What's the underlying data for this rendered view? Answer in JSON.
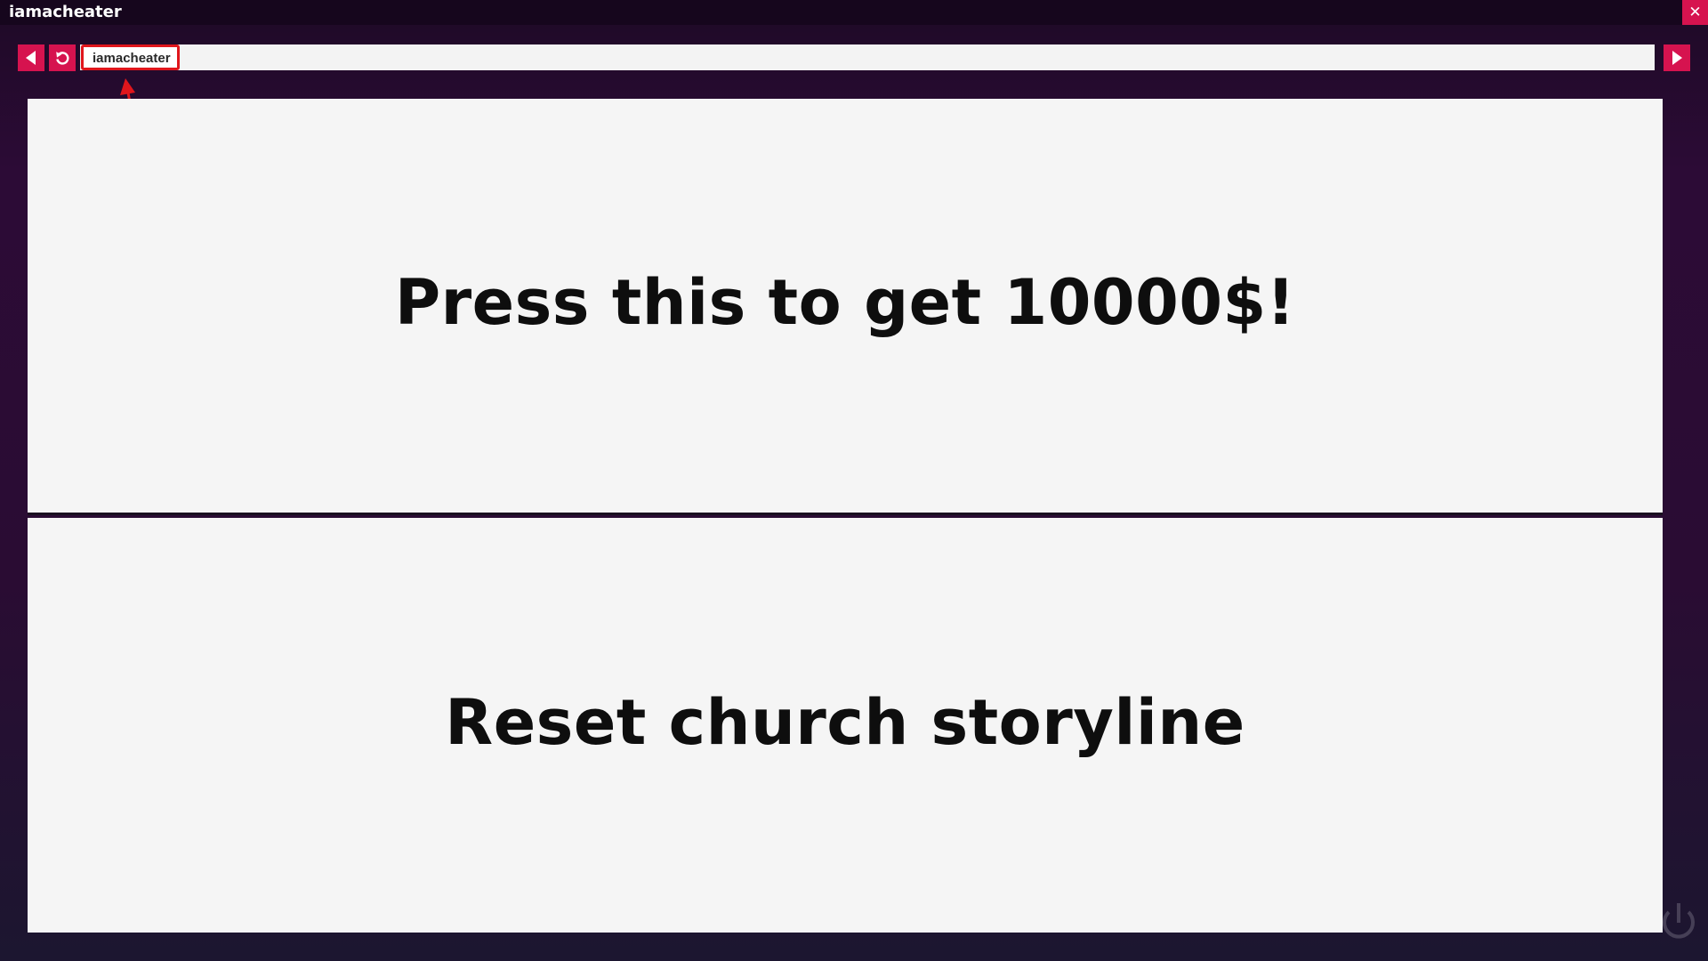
{
  "window": {
    "title": "iamacheater",
    "close_glyph": "✕"
  },
  "toolbar": {
    "back_icon": "back-arrow-icon",
    "reload_icon": "reload-icon",
    "forward_icon": "forward-arrow-icon",
    "accent_color": "#d6134f"
  },
  "address_bar": {
    "value": "iamacheater",
    "highlight_color": "#e0161c"
  },
  "panels": [
    {
      "label": "Press this to get 10000$!"
    },
    {
      "label": "Reset church storyline"
    }
  ]
}
